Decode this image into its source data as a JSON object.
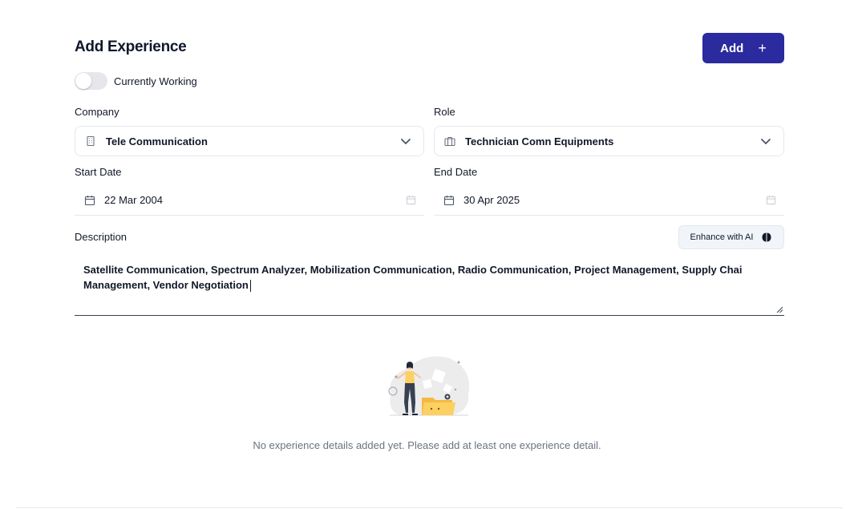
{
  "page": {
    "title": "Add Experience",
    "add_label": "Add",
    "add_icon": "plus-icon"
  },
  "toggle": {
    "label": "Currently Working",
    "on": false
  },
  "company": {
    "label": "Company",
    "value": "Tele Communication",
    "icon": "building-icon"
  },
  "role": {
    "label": "Role",
    "value": "Technician Comn Equipments",
    "icon": "briefcase-icon"
  },
  "start_date": {
    "label": "Start Date",
    "value": "22 Mar 2004"
  },
  "end_date": {
    "label": "End Date",
    "value": "30 Apr 2025"
  },
  "description": {
    "label": "Description",
    "enhance_label": "Enhance with AI",
    "value": "Satellite Communication, Spectrum Analyzer, Mobilization Communication, Radio Communication, Project Management, Supply Chai Management, Vendor Negotiation"
  },
  "empty_state": {
    "message": "No experience details added yet. Please add at least one experience detail."
  },
  "colors": {
    "primary": "#2b2a9e",
    "muted_text": "#6b7280",
    "border": "#e5e7eb"
  }
}
